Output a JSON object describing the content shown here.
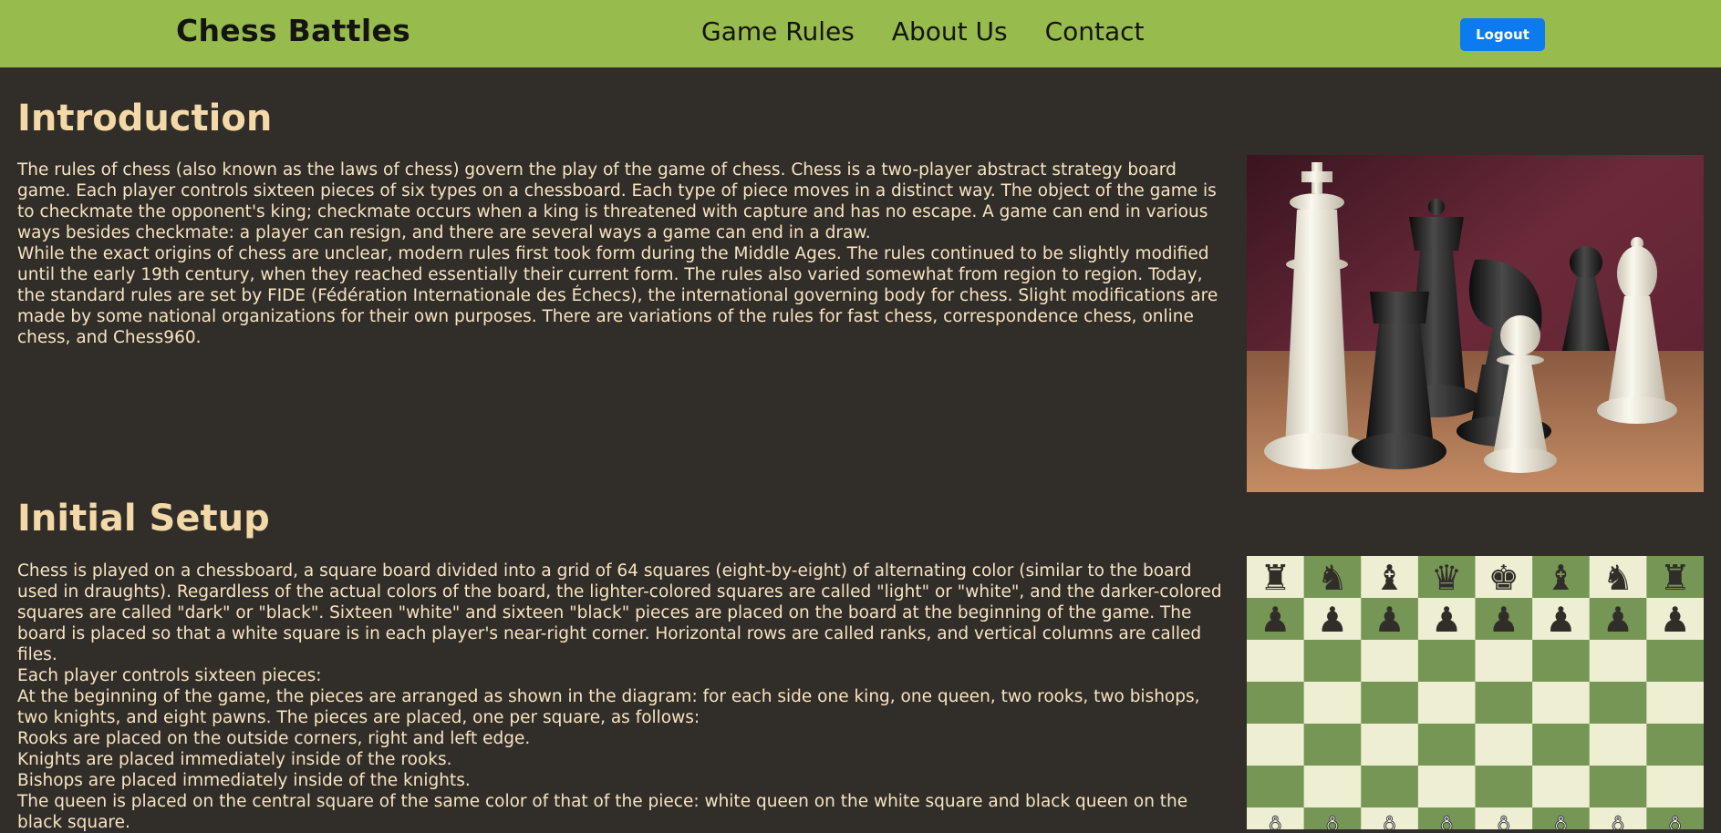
{
  "navbar": {
    "brand": "Chess Battles",
    "links": [
      "Game Rules",
      "About Us",
      "Contact"
    ],
    "logout_label": "Logout"
  },
  "intro": {
    "title": "Introduction",
    "paragraphs": [
      "The rules of chess (also known as the laws of chess) govern the play of the game of chess. Chess is a two-player abstract strategy board game. Each player controls sixteen pieces of six types on a chessboard. Each type of piece moves in a distinct way. The object of the game is to checkmate the opponent's king; checkmate occurs when a king is threatened with capture and has no escape. A game can end in various ways besides checkmate: a player can resign, and there are several ways a game can end in a draw.",
      "While the exact origins of chess are unclear, modern rules first took form during the Middle Ages. The rules continued to be slightly modified until the early 19th century, when they reached essentially their current form. The rules also varied somewhat from region to region. Today, the standard rules are set by FIDE (Fédération Internationale des Échecs), the international governing body for chess. Slight modifications are made by some national organizations for their own purposes. There are variations of the rules for fast chess, correspondence chess, online chess, and Chess960."
    ]
  },
  "setup": {
    "title": "Initial Setup",
    "paragraphs": [
      "Chess is played on a chessboard, a square board divided into a grid of 64 squares (eight-by-eight) of alternating color (similar to the board used in draughts). Regardless of the actual colors of the board, the lighter-colored squares are called \"light\" or \"white\", and the darker-colored squares are called \"dark\" or \"black\". Sixteen \"white\" and sixteen \"black\" pieces are placed on the board at the beginning of the game. The board is placed so that a white square is in each player's near-right corner. Horizontal rows are called ranks, and vertical columns are called files.",
      "Each player controls sixteen pieces:",
      "At the beginning of the game, the pieces are arranged as shown in the diagram: for each side one king, one queen, two rooks, two bishops, two knights, and eight pawns. The pieces are placed, one per square, as follows:",
      "Rooks are placed on the outside corners, right and left edge.",
      "Knights are placed immediately inside of the rooks.",
      "Bishops are placed immediately inside of the knights.",
      "The queen is placed on the central square of the same color of that of the piece: white queen on the white square and black queen on the black square."
    ]
  },
  "colors": {
    "navbar": "#98bb4e",
    "background": "#312d29",
    "heading": "#f4d9a8",
    "text": "#f7e4c1",
    "logout": "#0d7bf0",
    "board_light": "#eeeed2",
    "board_dark": "#769656"
  },
  "board": {
    "back_rank_black": [
      "♜",
      "♞",
      "♝",
      "♛",
      "♚",
      "♝",
      "♞",
      "♜"
    ],
    "pawn_black": "♟",
    "pawn_white": "♙"
  }
}
